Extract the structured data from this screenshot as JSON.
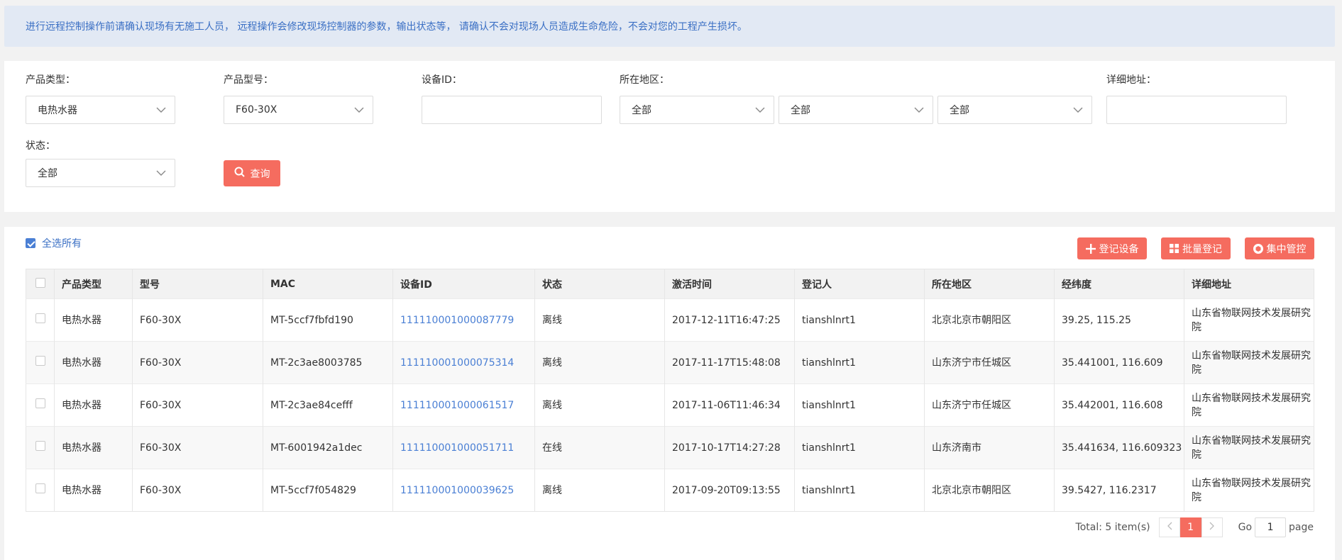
{
  "notice": {
    "text": "进行远程控制操作前请确认现场有无施工人员，  远程操作会修改现场控制器的参数，输出状态等，  请确认不会对现场人员造成生命危险，不会对您的工程产生损坏。"
  },
  "filters": {
    "product_type": {
      "label": "产品类型：",
      "value": "电热水器"
    },
    "product_model": {
      "label": "产品型号：",
      "value": "F60-30X"
    },
    "device_id": {
      "label": "设备ID：",
      "value": "",
      "placeholder": ""
    },
    "region": {
      "label": "所在地区：",
      "province": "全部",
      "city": "全部",
      "district": "全部"
    },
    "address": {
      "label": "详细地址：",
      "value": "",
      "placeholder": ""
    },
    "status": {
      "label": "状态：",
      "value": "全部"
    },
    "query_label": "查询"
  },
  "toolbar": {
    "select_all_label": "全选所有",
    "select_all_checked": true,
    "register_label": "登记设备",
    "batch_register_label": "批量登记",
    "central_control_label": "集中管控"
  },
  "table": {
    "headers": [
      "产品类型",
      "型号",
      "MAC",
      "设备ID",
      "状态",
      "激活时间",
      "登记人",
      "所在地区",
      "经纬度",
      "详细地址"
    ],
    "rows": [
      [
        "电热水器",
        "F60-30X",
        "MT-5ccf7fbfd190",
        "111110001000087779",
        "离线",
        "2017-12-11T16:47:25",
        "tianshlnrt1",
        "北京北京市朝阳区",
        "39.25, 115.25",
        "山东省物联网技术发展研究院"
      ],
      [
        "电热水器",
        "F60-30X",
        "MT-2c3ae8003785",
        "111110001000075314",
        "离线",
        "2017-11-17T15:48:08",
        "tianshlnrt1",
        "山东济宁市任城区",
        "35.441001, 116.609",
        "山东省物联网技术发展研究院"
      ],
      [
        "电热水器",
        "F60-30X",
        "MT-2c3ae84cefff",
        "111110001000061517",
        "离线",
        "2017-11-06T11:46:34",
        "tianshlnrt1",
        "山东济宁市任城区",
        "35.442001, 116.608",
        "山东省物联网技术发展研究院"
      ],
      [
        "电热水器",
        "F60-30X",
        "MT-6001942a1dec",
        "111110001000051711",
        "在线",
        "2017-10-17T14:27:28",
        "tianshlnrt1",
        "山东济南市",
        "35.441634, 116.609323",
        "山东省物联网技术发展研究院"
      ],
      [
        "电热水器",
        "F60-30X",
        "MT-5ccf7f054829",
        "111110001000039625",
        "离线",
        "2017-09-20T09:13:55",
        "tianshlnrt1",
        "北京北京市朝阳区",
        "39.5427, 116.2317",
        "山东省物联网技术发展研究院"
      ]
    ]
  },
  "pagination": {
    "total_text": "Total: 5 item(s)",
    "current_page": "1",
    "go_label": "Go",
    "go_value": "1",
    "page_label": "page"
  },
  "colors": {
    "accent": "#f56c5f",
    "link": "#4a7fd4",
    "notice_bg": "#e2e9f4"
  }
}
